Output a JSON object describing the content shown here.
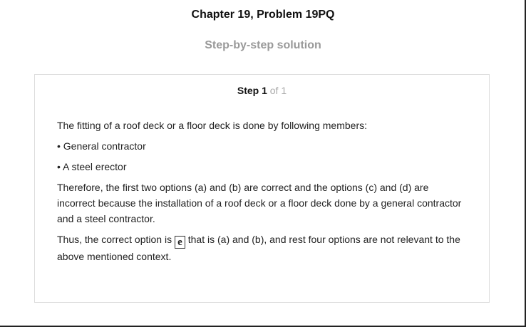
{
  "header": {
    "title": "Chapter 19, Problem 19PQ",
    "subtitle": "Step-by-step solution"
  },
  "step": {
    "label": "Step 1",
    "of": "of 1"
  },
  "content": {
    "p1": "The fitting of a roof deck or a floor deck is done by following members:",
    "bullets": [
      "• General contractor",
      "• A steel erector"
    ],
    "p2": "Therefore, the first two options (a) and (b) are correct and the options (c) and (d) are incorrect because the installation of a roof deck or a floor deck done by a general contractor and a steel contractor.",
    "p3_before": "Thus, the correct option is",
    "answer": "e",
    "p3_after": "that is (a) and (b), and rest four options are not relevant to the above mentioned context."
  }
}
